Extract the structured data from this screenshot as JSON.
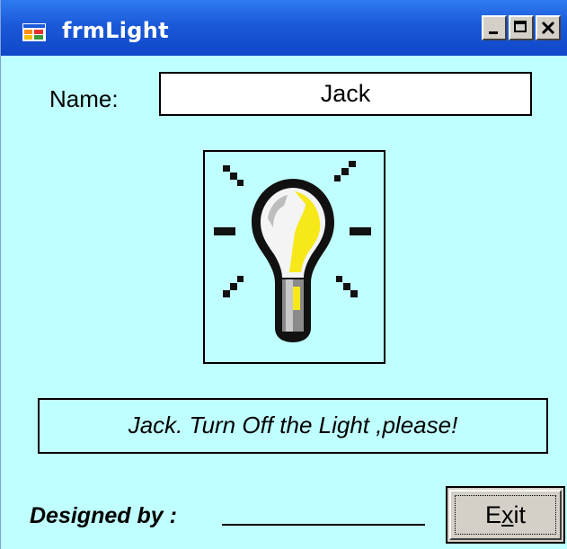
{
  "window": {
    "title": "frmLight",
    "icon": "form-icon",
    "controls": [
      "minimize-icon",
      "maximize-icon",
      "close-icon"
    ]
  },
  "form": {
    "name_label": "Name:",
    "name_value": "Jack",
    "picture": "lightbulb-on-icon",
    "message": "Jack. Turn Off the Light ,please!",
    "designed_by_label": "Designed by :",
    "exit_button": {
      "pre": "E",
      "accel": "x",
      "post": "it"
    }
  },
  "colors": {
    "form_background": "#c0ffff",
    "titlebar": "#1b59d9",
    "button_face": "#d4d0c8"
  }
}
